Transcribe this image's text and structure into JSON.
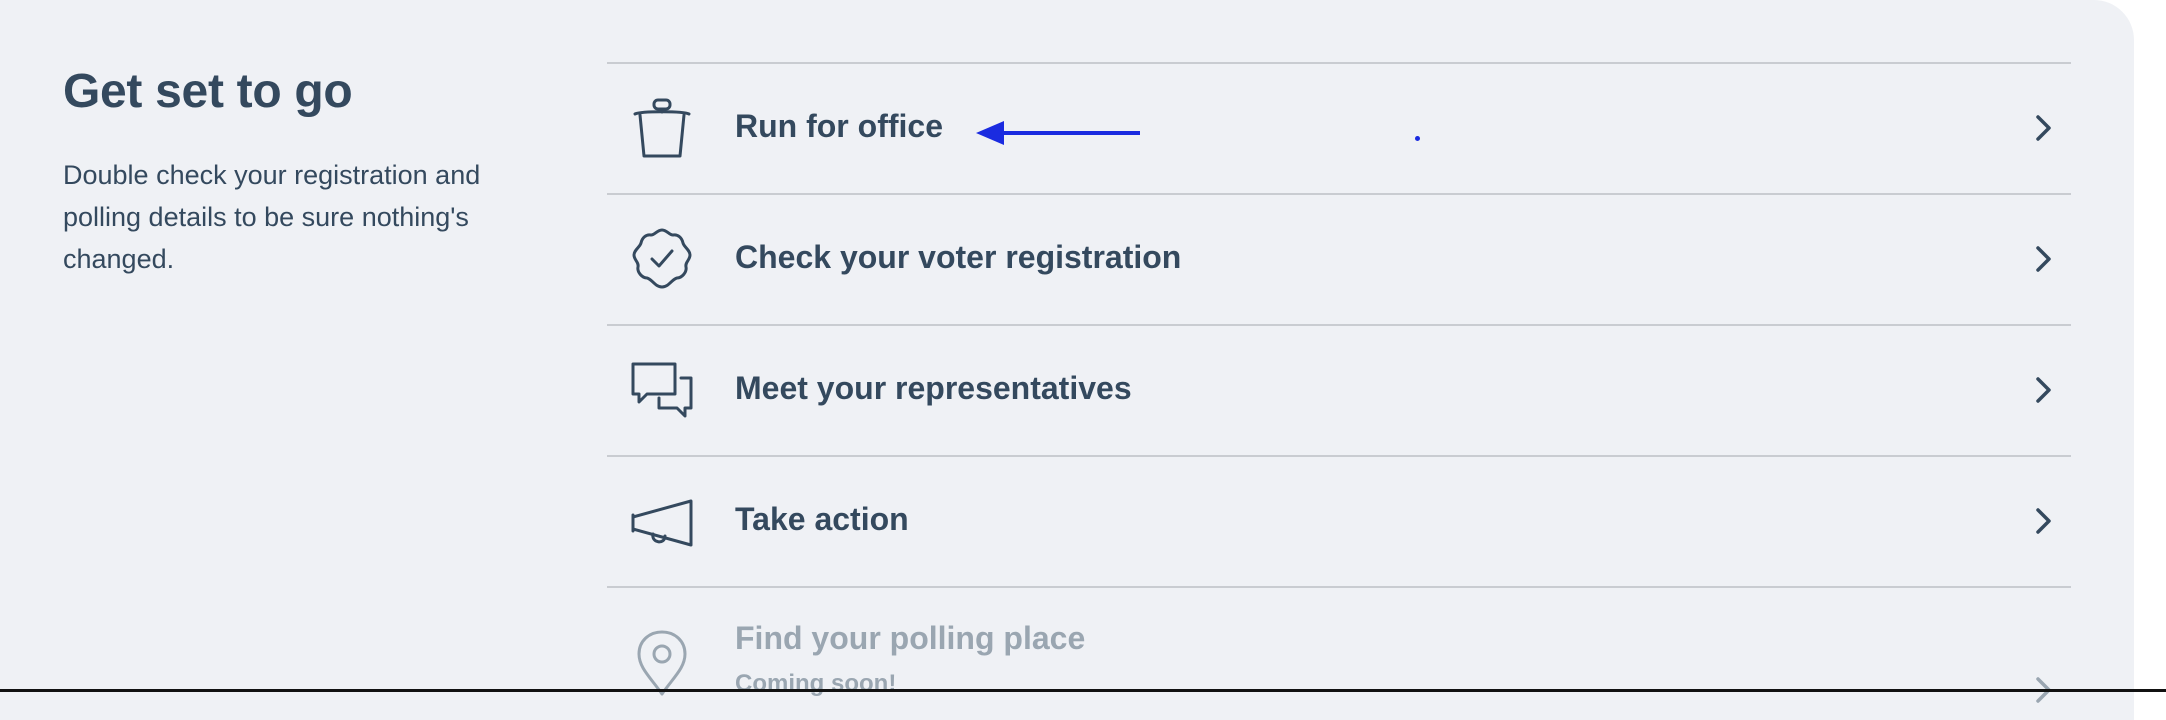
{
  "intro": {
    "title": "Get set to go",
    "description": "Double check your registration and polling details to be sure nothing's changed."
  },
  "items": [
    {
      "label": "Run for office",
      "icon": "podium-icon",
      "enabled": true
    },
    {
      "label": "Check your voter registration",
      "icon": "badge-check-icon",
      "enabled": true
    },
    {
      "label": "Meet your representatives",
      "icon": "chat-bubbles-icon",
      "enabled": true
    },
    {
      "label": "Take action",
      "icon": "megaphone-icon",
      "enabled": true
    },
    {
      "label": "Find your polling place",
      "sublabel": "Coming soon!",
      "icon": "map-pin-icon",
      "enabled": false
    }
  ],
  "colors": {
    "text": "#34495e",
    "muted": "#9aa6b1",
    "card_background": "#eff1f5",
    "divider": "#c9ccd1",
    "annotation": "#1a2be0"
  }
}
